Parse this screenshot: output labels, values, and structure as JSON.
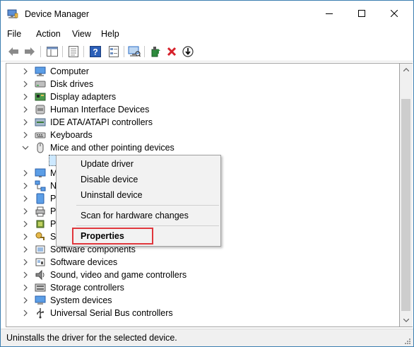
{
  "window": {
    "title": "Device Manager"
  },
  "menu": [
    "File",
    "Action",
    "View",
    "Help"
  ],
  "toolbar_icons": [
    "back-arrow-icon",
    "forward-arrow-icon",
    "show-hide-console-tree-icon",
    "properties-sheet-icon",
    "help-icon",
    "device-list-icon",
    "scan-hardware-icon",
    "update-driver-icon",
    "uninstall-icon",
    "disable-device-icon"
  ],
  "tree": {
    "items": [
      {
        "label": "Computer",
        "icon": "computer-icon",
        "expanded": false
      },
      {
        "label": "Disk drives",
        "icon": "disk-drive-icon",
        "expanded": false
      },
      {
        "label": "Display adapters",
        "icon": "display-adapter-icon",
        "expanded": false
      },
      {
        "label": "Human Interface Devices",
        "icon": "hid-icon",
        "expanded": false
      },
      {
        "label": "IDE ATA/ATAPI controllers",
        "icon": "ide-controller-icon",
        "expanded": false
      },
      {
        "label": "Keyboards",
        "icon": "keyboard-icon",
        "expanded": false
      },
      {
        "label": "Mice and other pointing devices",
        "icon": "mouse-icon",
        "expanded": true
      },
      {
        "label": "",
        "icon": "mouse-icon",
        "child": true
      },
      {
        "label": "M",
        "icon": "monitor-icon",
        "expanded": false
      },
      {
        "label": "N",
        "icon": "network-adapter-icon",
        "expanded": false
      },
      {
        "label": "P",
        "icon": "portable-device-icon",
        "expanded": false
      },
      {
        "label": "P",
        "icon": "print-queue-icon",
        "expanded": false
      },
      {
        "label": "P",
        "icon": "processor-icon",
        "expanded": false
      },
      {
        "label": "S",
        "icon": "security-device-icon",
        "expanded": false
      },
      {
        "label": "Software components",
        "icon": "software-component-icon",
        "expanded": false
      },
      {
        "label": "Software devices",
        "icon": "software-device-icon",
        "expanded": false
      },
      {
        "label": "Sound, video and game controllers",
        "icon": "sound-icon",
        "expanded": false
      },
      {
        "label": "Storage controllers",
        "icon": "storage-controller-icon",
        "expanded": false
      },
      {
        "label": "System devices",
        "icon": "system-device-icon",
        "expanded": false
      },
      {
        "label": "Universal Serial Bus controllers",
        "icon": "usb-icon",
        "expanded": false
      }
    ]
  },
  "context_menu": {
    "update_driver": "Update driver",
    "disable_device": "Disable device",
    "uninstall_device": "Uninstall device",
    "scan": "Scan for hardware changes",
    "properties": "Properties"
  },
  "status": {
    "text": "Uninstalls the driver for the selected device."
  },
  "colors": {
    "highlight_border": "#e0363c",
    "window_border": "#3c7fb1",
    "icon_blue": "#2b6cc4"
  }
}
